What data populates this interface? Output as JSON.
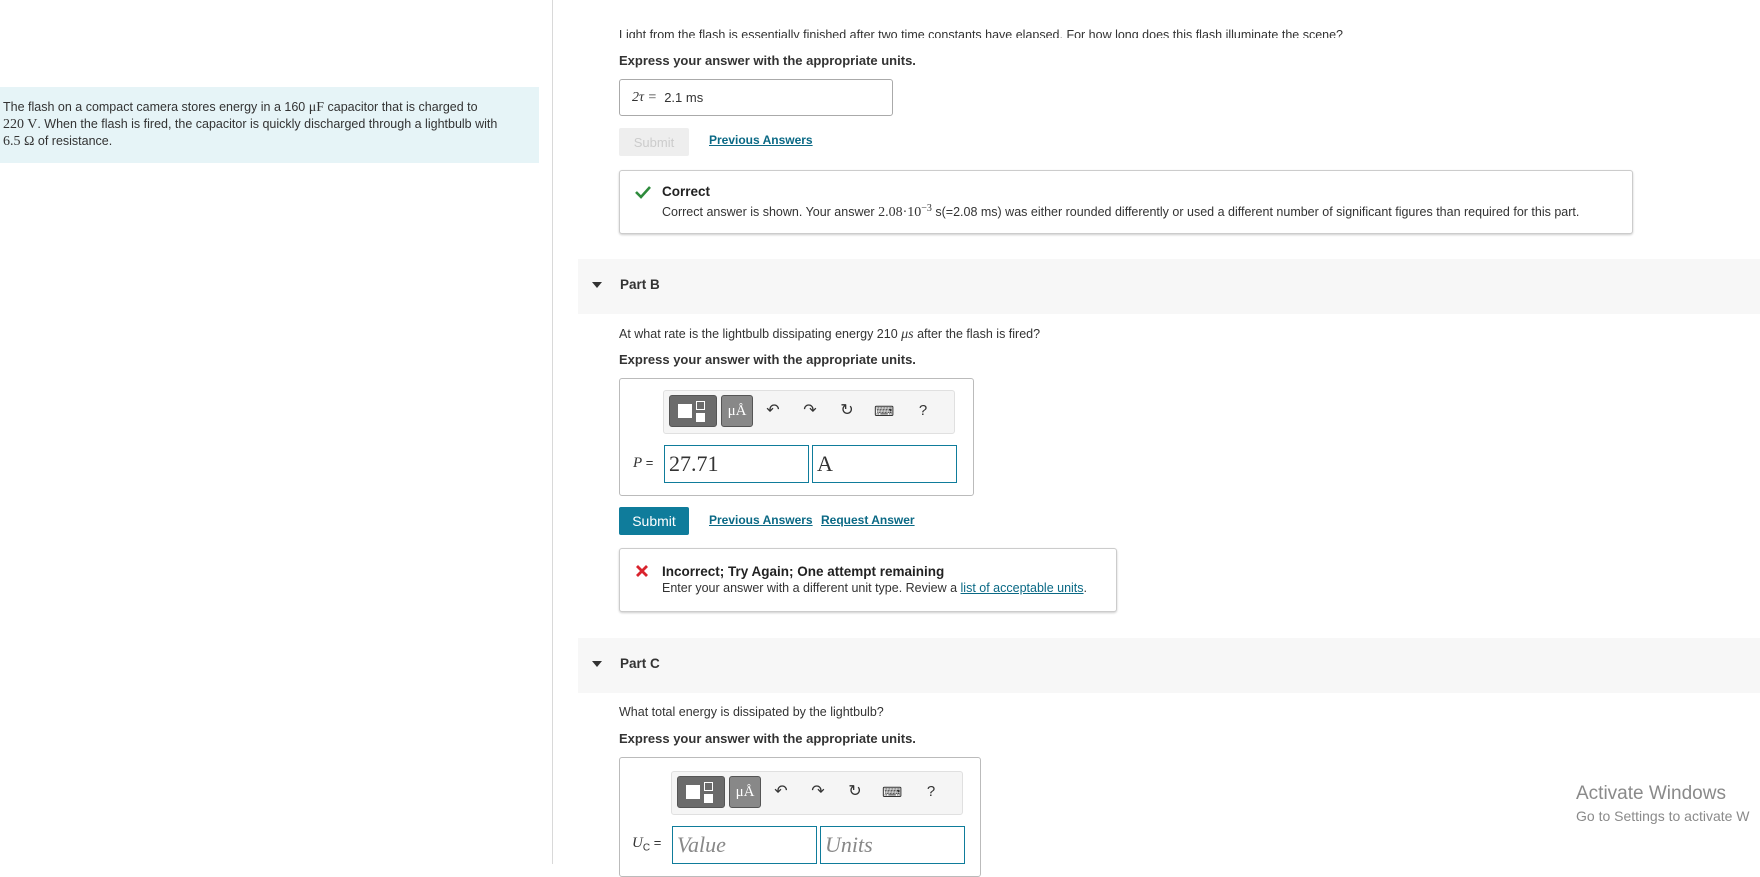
{
  "problem": {
    "text_1": "The flash on a compact camera stores energy in a 160 ",
    "unit_cap": "μF",
    "text_2": " capacitor that is charged to",
    "voltage": "220 V",
    "text_3": ". When the flash is fired, the capacitor is quickly discharged through a lightbulb with",
    "resistance": "6.5 Ω",
    "text_4": " of resistance."
  },
  "part_a": {
    "cut_question": "Light from the flash is essentially finished after two time constants have elapsed. For how long does this flash illuminate the scene?",
    "express": "Express your answer with the appropriate units.",
    "answer_label": "2τ =",
    "answer_value": "2.1 ms",
    "submit_label": "Submit",
    "previous_answers": "Previous Answers",
    "feedback_title": "Correct",
    "feedback_text_1": "Correct answer is shown. Your answer ",
    "feedback_value": "2.08·10",
    "feedback_exp": "−3",
    "feedback_text_2": " s(=2.08 ms) was either rounded differently or used a different number of significant figures than required for this part."
  },
  "part_b": {
    "header": "Part B",
    "question_1": "At what rate is the lightbulb dissipating energy 210 ",
    "question_unit": "μs",
    "question_2": " after the flash is fired?",
    "express": "Express your answer with the appropriate units.",
    "toolbar_units": "μÅ",
    "toolbar_help": "?",
    "var_label": "P",
    "equals": "=",
    "value": "27.71",
    "unit": "A",
    "submit_label": "Submit",
    "previous_answers": "Previous Answers",
    "request_answer": "Request Answer",
    "feedback_title": "Incorrect; Try Again; One attempt remaining",
    "feedback_text": "Enter your answer with a different unit type. Review a ",
    "feedback_link": "list of acceptable units",
    "feedback_end": "."
  },
  "part_c": {
    "header": "Part C",
    "question": "What total energy is dissipated by the lightbulb?",
    "express": "Express your answer with the appropriate units.",
    "toolbar_units": "μÅ",
    "toolbar_help": "?",
    "var_label": "U",
    "var_sub": "C",
    "equals": "=",
    "value_placeholder": "Value",
    "units_placeholder": "Units"
  },
  "watermark": {
    "title": "Activate Windows",
    "subtitle": "Go to Settings to activate W"
  },
  "colors": {
    "accent": "#0f7c9b",
    "correct": "#2e8b3c",
    "incorrect": "#d9232d",
    "problem_bg": "#e6f4f7"
  }
}
